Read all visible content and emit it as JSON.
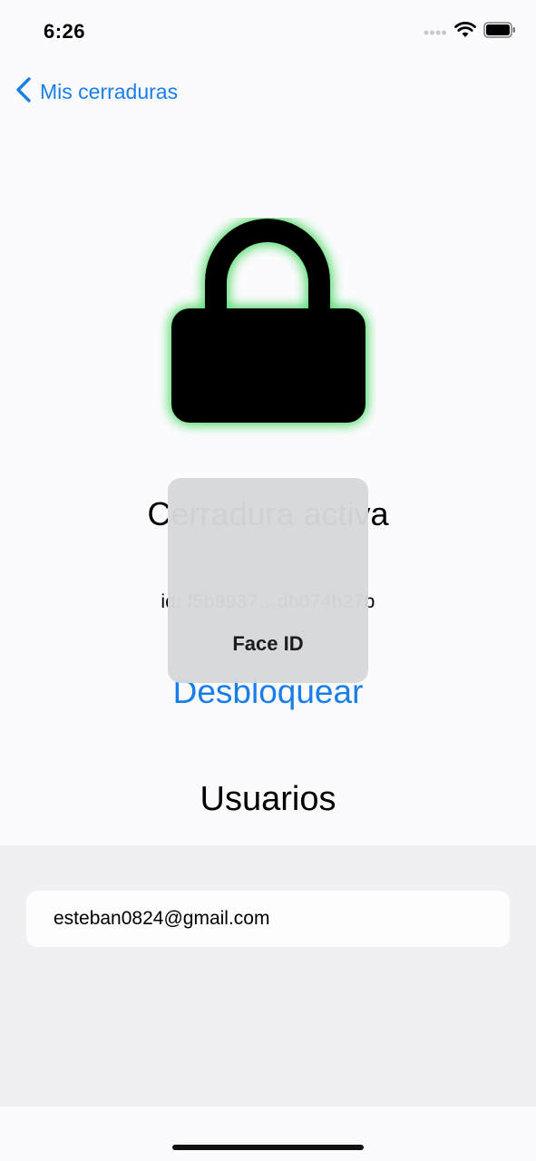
{
  "status_bar": {
    "time": "6:26",
    "icons": [
      "cellular-signal-icon",
      "wifi-icon",
      "battery-icon"
    ]
  },
  "nav": {
    "back_label": "Mis cerraduras",
    "back_icon": "chevron-left-icon"
  },
  "lock": {
    "icon": "padlock-icon",
    "glow_color": "#4cd964",
    "title": "Cerradura activa",
    "id": "id: f5b9937…db074b27b"
  },
  "actions": {
    "unlock_label": "Desbloquear"
  },
  "users": {
    "section_title": "Usuarios",
    "items": [
      {
        "email": "esteban0824@gmail.com"
      }
    ]
  },
  "faceid": {
    "label": "Face ID"
  },
  "colors": {
    "accent": "#1a7ee8",
    "background": "#fbfbfd",
    "list_background": "#efeff4"
  }
}
